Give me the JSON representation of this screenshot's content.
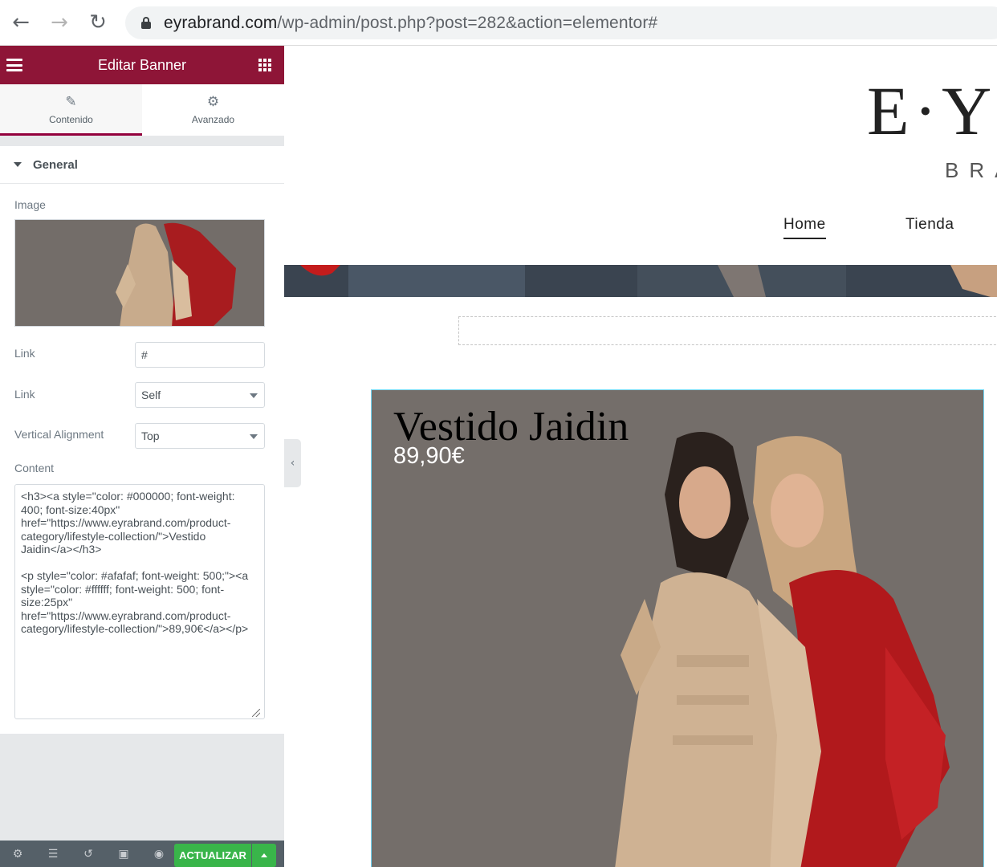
{
  "browser": {
    "url_domain": "eyrabrand.com",
    "url_path": "/wp-admin/post.php?post=282&action=elementor#"
  },
  "panel": {
    "title": "Editar Banner",
    "tabs": [
      {
        "label": "Contenido",
        "icon": "pencil-icon",
        "active": true
      },
      {
        "label": "Avanzado",
        "icon": "gear-icon",
        "active": false
      }
    ],
    "section_title": "General",
    "image_label": "Image",
    "link_label": "Link",
    "link_value": "#",
    "link_target_label": "Link",
    "link_target_value": "Self",
    "valign_label": "Vertical Alignment",
    "valign_value": "Top",
    "content_label": "Content",
    "content_value": "<h3><a style=\"color: #000000; font-weight: 400; font-size:40px\" href=\"https://www.eyrabrand.com/product-category/lifestyle-collection/\">Vestido Jaidin</a></h3>\n\n<p style=\"color: #afafaf; font-weight: 500;\"><a style=\"color: #ffffff; font-weight: 500; font-size:25px\" href=\"https://www.eyrabrand.com/product-category/lifestyle-collection/\">89,90€</a></p>",
    "update_label": "ACTUALIZAR",
    "accent_color": "#8e1537",
    "button_color": "#39b54a"
  },
  "preview": {
    "logo_main": "E·Y·",
    "logo_sub": "BRA",
    "menu": [
      "Home",
      "Tienda"
    ],
    "banner_title": "Vestido Jaidin",
    "banner_price": "89,90€"
  }
}
